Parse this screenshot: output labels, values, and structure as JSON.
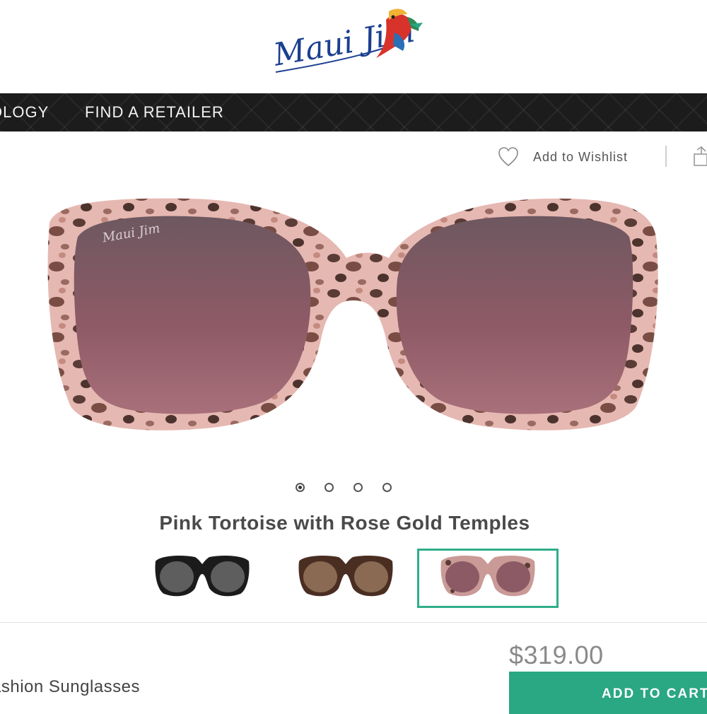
{
  "brand": {
    "logo_text": "Maui Jim",
    "colors": {
      "navy": "#1b3f8f",
      "accent": "#2aa783"
    }
  },
  "nav": {
    "items": [
      {
        "label": "OLOGY"
      },
      {
        "label": "FIND A RETAILER"
      }
    ]
  },
  "actions": {
    "wishlist_label": "Add to Wishlist",
    "wishlist_icon": "heart-icon",
    "share_icon": "share-icon"
  },
  "gallery": {
    "dots": [
      {
        "active": true
      },
      {
        "active": false
      },
      {
        "active": false
      },
      {
        "active": false
      }
    ]
  },
  "product": {
    "color_name": "Pink Tortoise with Rose Gold Temples",
    "swatches": [
      {
        "name": "black",
        "selected": false
      },
      {
        "name": "tortoise",
        "selected": false
      },
      {
        "name": "pink-tortoise",
        "selected": true
      }
    ],
    "price": "$319.00",
    "category": "ashion Sunglasses",
    "add_to_cart_label": "ADD TO CART"
  }
}
